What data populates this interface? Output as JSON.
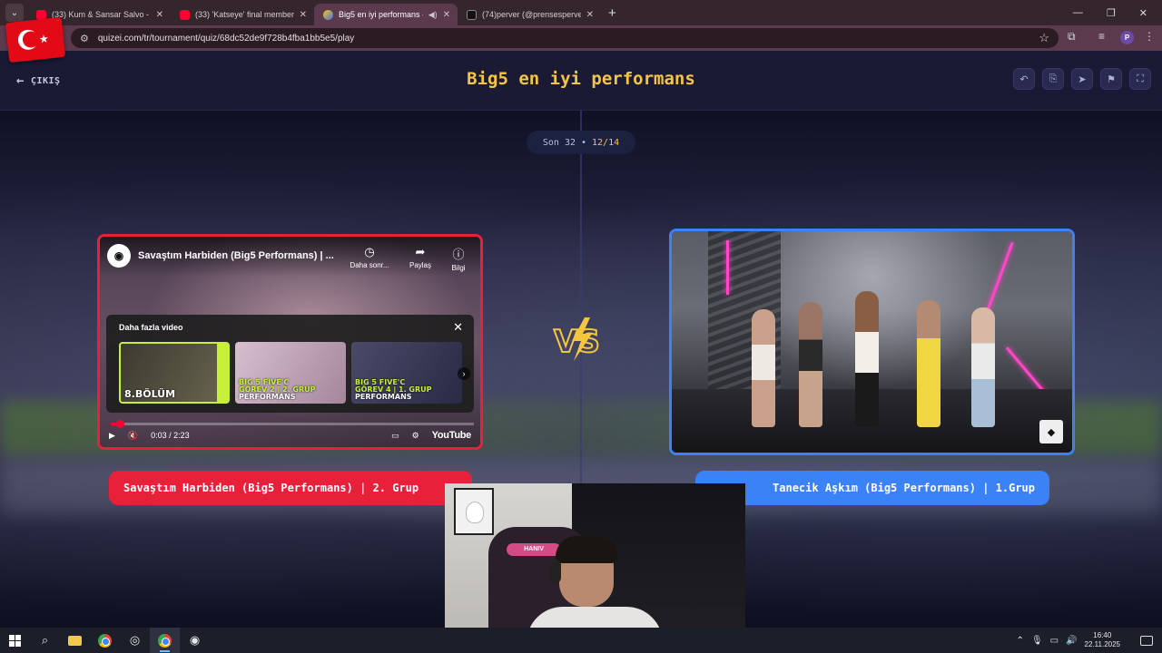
{
  "browser": {
    "tabs": [
      {
        "title": "(33) Kum & Sansar Salvo - Kırm",
        "favicon": "youtube-icon",
        "active": false
      },
      {
        "title": "(33) 'Katseye' final members | D",
        "favicon": "youtube-icon",
        "active": false
      },
      {
        "title": "Big5 en iyi performans - Tu",
        "favicon": "quizei-icon",
        "active": true
      },
      {
        "title": "(74)perver (@prensesperver) | T",
        "favicon": "tiktok-icon",
        "active": false
      }
    ],
    "url": "quizei.com/tr/tournament/quiz/68dc52de9f728b4fba1bb5e5/play",
    "profile_initial": "P"
  },
  "quiz": {
    "exit_label": "ÇIKIŞ",
    "title": "Big5 en iyi performans",
    "round_label": "Son 32",
    "separator": "•",
    "progress_text": "12/14",
    "accent_color": "#f5c542"
  },
  "left_option": {
    "border_color": "#e8203a",
    "name": "Savaştım Harbiden (Big5 Performans) | 2. Grup",
    "video": {
      "title": "Savaştım Harbiden (Big5 Performans) | ...",
      "watch_later_label": "Daha sonr...",
      "share_label": "Paylaş",
      "info_label": "Bilgi",
      "more_videos_label": "Daha fazla video",
      "thumbnails": [
        {
          "lines": [
            "8.BÖLÜM"
          ]
        },
        {
          "lines": [
            "BIG 5 FIVE'C",
            "GÖREV 2 | 2. GRUP",
            "PERFORMANS"
          ]
        },
        {
          "lines": [
            "BIG 5 FIVE'C",
            "GÖREV 4 | 1. GRUP",
            "PERFORMANS"
          ]
        }
      ],
      "time": "0:03 / 2:23",
      "brand": "YouTube"
    }
  },
  "right_option": {
    "border_color": "#3b82f6",
    "name": "Tanecik Aşkım (Big5 Performans) | 1.Grup"
  },
  "webcam": {
    "chair_brand": "HANIV"
  },
  "taskbar": {
    "time": "16:40",
    "date": "22.11.2025"
  }
}
